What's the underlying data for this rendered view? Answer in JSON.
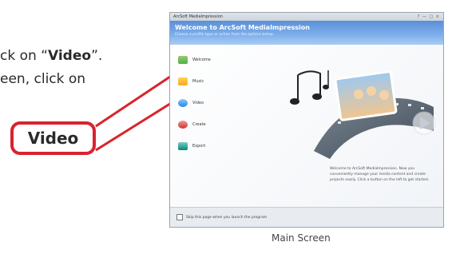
{
  "instructions": {
    "line1_prefix": "ck on “",
    "line1_bold": "Video",
    "line1_suffix": "”.",
    "line2": "een, click on"
  },
  "callout": {
    "label": "Video"
  },
  "window": {
    "title": "ArcSoft MediaImpression",
    "controls": "? — □ ×",
    "header_title": "Welcome to ArcSoft MediaImpression",
    "header_sub": "Choose a profile type or action from the options below.",
    "menu": [
      {
        "label": "Welcome",
        "icon": "welcome-icon"
      },
      {
        "label": "Music",
        "icon": "music-icon"
      },
      {
        "label": "Video",
        "icon": "video-icon"
      },
      {
        "label": "Create",
        "icon": "create-icon"
      },
      {
        "label": "Export",
        "icon": "export-icon"
      }
    ],
    "welcome_text": "Welcome to ArcSoft MediaImpression. Now you conveniently manage your media content and create projects easily. Click a button on the left to get started.",
    "footer_checkbox": "Skip this page when you launch the program"
  },
  "caption": "Main Screen",
  "colors": {
    "callout_red": "#d9232e",
    "header_blue": "#5b8fd6"
  }
}
